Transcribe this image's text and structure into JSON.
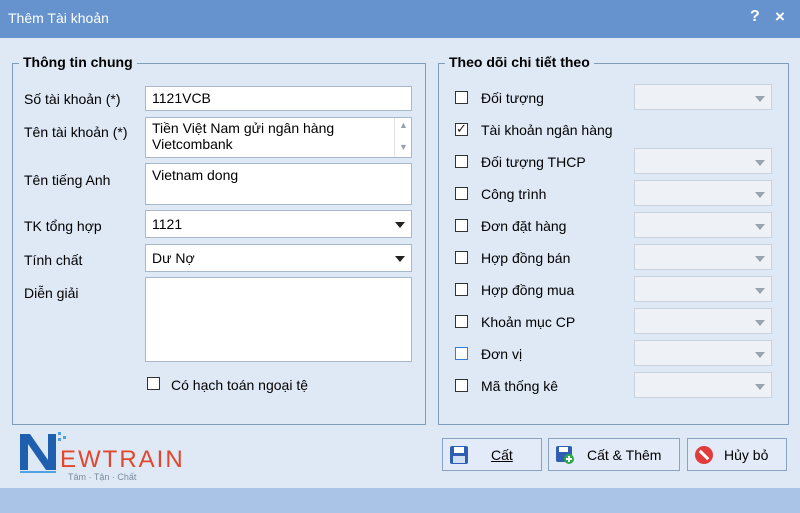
{
  "window": {
    "title": "Thêm Tài khoản",
    "help": "?",
    "close": "×"
  },
  "general": {
    "title": "Thông tin chung",
    "account_no_label": "Số tài khoản (*)",
    "account_no_value": "1121VCB",
    "account_name_label": "Tên tài khoản (*)",
    "account_name_value": "Tiền Việt Nam gửi ngân hàng\nVietcombank",
    "english_name_label": "Tên tiếng Anh",
    "english_name_value": "Vietnam dong",
    "parent_label": "TK tổng hợp",
    "parent_value": "1121",
    "nature_label": "Tính chất",
    "nature_value": "Dư Nợ",
    "description_label": "Diễn giải",
    "description_value": "",
    "foreign_currency_label": "Có hạch toán ngoại tệ",
    "foreign_currency_checked": false
  },
  "tracking": {
    "title": "Theo dõi chi tiết theo",
    "items": [
      {
        "label": "Đối tượng",
        "checked": false
      },
      {
        "label": "Tài khoản ngân hàng",
        "checked": true
      },
      {
        "label": "Đối tượng THCP",
        "checked": false
      },
      {
        "label": "Công trình",
        "checked": false
      },
      {
        "label": "Đơn đặt hàng",
        "checked": false
      },
      {
        "label": "Hợp đồng bán",
        "checked": false
      },
      {
        "label": "Hợp đồng mua",
        "checked": false
      },
      {
        "label": "Khoản mục CP",
        "checked": false
      },
      {
        "label": "Đơn vị",
        "checked": false
      },
      {
        "label": "Mã thống kê",
        "checked": false
      }
    ]
  },
  "buttons": {
    "save": "Cất",
    "save_add": "Cất & Thêm",
    "cancel": "Hủy bỏ"
  },
  "logo": {
    "text": "EWTRAIN",
    "slogan": "Tâm · Tận · Chất"
  },
  "colors": {
    "titlebar": "#6693cd",
    "background": "#dfe9f6",
    "footer": "#a9c4e6",
    "logo_red": "#e0472c",
    "logo_blue": "#1f5fb0"
  }
}
